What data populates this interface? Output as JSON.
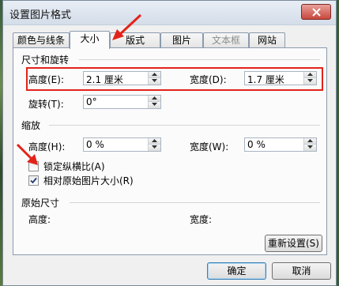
{
  "window": {
    "title": "设置图片格式"
  },
  "tabs": [
    {
      "label": "颜色与线条",
      "state": "normal"
    },
    {
      "label": "大小",
      "state": "active"
    },
    {
      "label": "版式",
      "state": "normal"
    },
    {
      "label": "图片",
      "state": "normal"
    },
    {
      "label": "文本框",
      "state": "disabled"
    },
    {
      "label": "网站",
      "state": "normal"
    }
  ],
  "size_rotate": {
    "section_title": "尺寸和旋转",
    "height_label": "高度(E):",
    "height_value": "2.1 厘米",
    "width_label": "宽度(D):",
    "width_value": "1.7 厘米",
    "rotate_label": "旋转(T):",
    "rotate_value": "0°"
  },
  "scale": {
    "section_title": "缩放",
    "height_label": "高度(H):",
    "height_value": "0 %",
    "width_label": "宽度(W):",
    "width_value": "0 %",
    "lock_aspect_label": "锁定纵横比(A)",
    "lock_aspect_checked": false,
    "relative_original_label": "相对原始图片大小(R)",
    "relative_original_checked": true
  },
  "original": {
    "section_title": "原始尺寸",
    "height_label": "高度:",
    "width_label": "宽度:",
    "reset_label": "重新设置(S)"
  },
  "footer": {
    "ok_label": "确定",
    "cancel_label": "取消"
  },
  "colors": {
    "highlight": "#e2231a",
    "annotation_arrow": "#e2231a"
  },
  "icons": {
    "close": "close-icon",
    "spin_up": "spin-up-icon",
    "spin_down": "spin-down-icon",
    "check": "checkmark-icon"
  }
}
